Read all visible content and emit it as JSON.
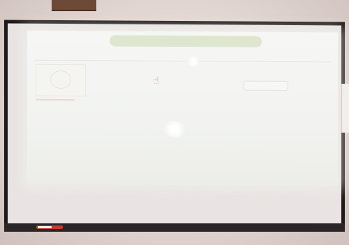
{
  "scene": {
    "description_colors": {
      "wall": "#ded2cd",
      "board_frame": "#1e1a1b",
      "projection": "#f4f4f2",
      "marker": "#c63a32"
    }
  },
  "projected_ui": {
    "chrome_tabs": [
      "",
      "",
      ""
    ],
    "header": {
      "logo_text": "",
      "nav_text": ""
    },
    "search": {
      "value": ""
    },
    "cells": [
      "",
      "",
      "",
      ""
    ]
  },
  "icons": [
    "hand-pointer-icon"
  ]
}
